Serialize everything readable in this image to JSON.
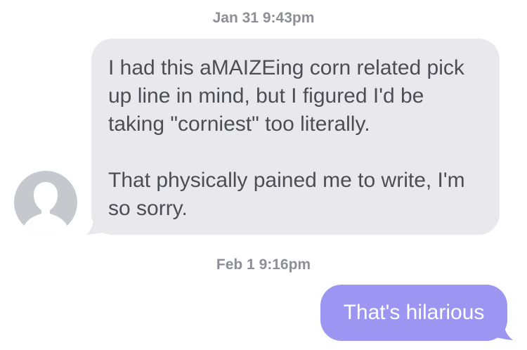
{
  "conversation": {
    "messages": [
      {
        "timestamp": "Jan 31 9:43pm",
        "direction": "incoming",
        "sender_avatar": "person-silhouette-icon",
        "paragraphs": [
          "I had this aMAIZEing corn related pick up line in mind, but I figured I'd be taking \"corniest\" too literally.",
          "That physically pained me to write, I'm so sorry."
        ]
      },
      {
        "timestamp": "Feb 1 9:16pm",
        "direction": "outgoing",
        "text": "That's hilarious"
      }
    ]
  },
  "colors": {
    "incoming_bubble": "#e8e8ed",
    "incoming_text": "#4d4d55",
    "outgoing_bubble": "#9c96f2",
    "outgoing_text": "#ffffff",
    "timestamp": "#8e8e96",
    "avatar_bg": "#c6c8ce"
  }
}
